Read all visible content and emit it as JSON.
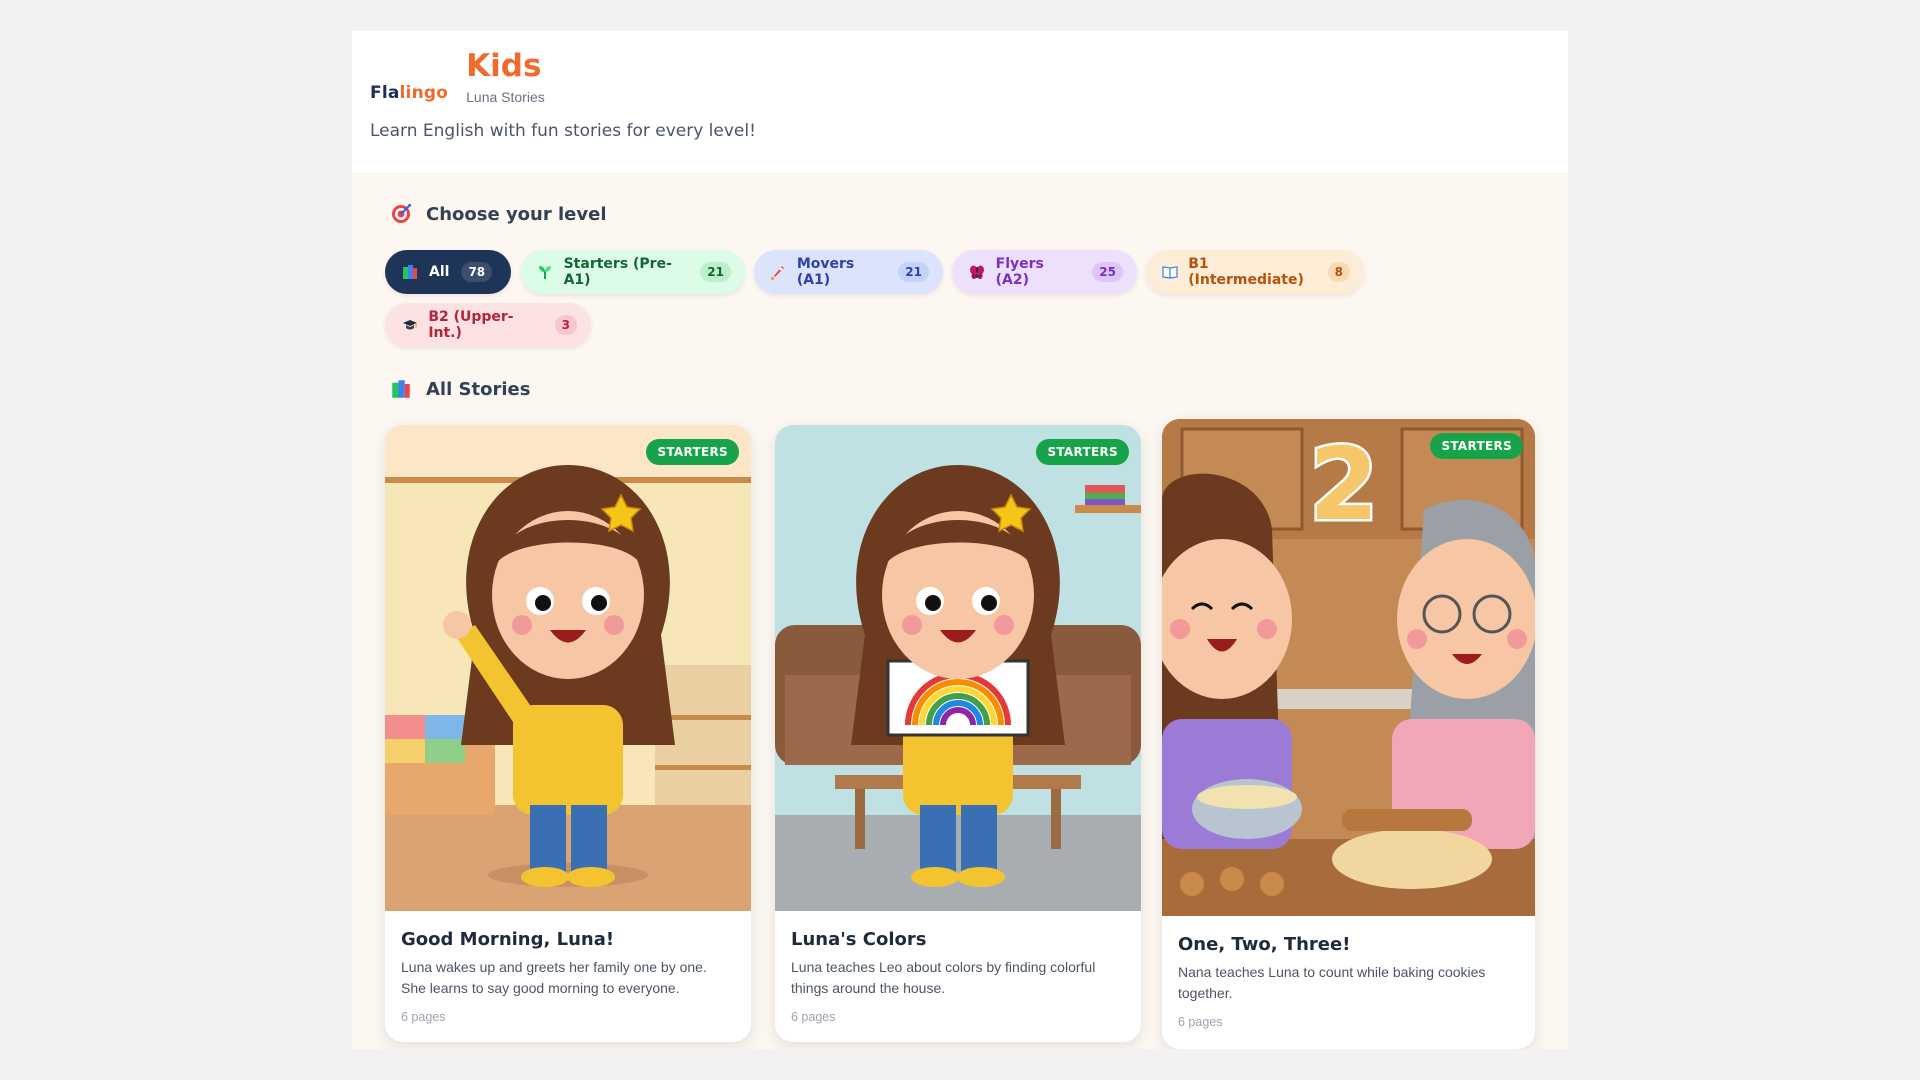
{
  "brand": {
    "logo_part1": "Fla",
    "logo_part2": "lingo",
    "title": "Kids",
    "subtitle": "Luna Stories"
  },
  "tagline": "Learn English with fun stories for every level!",
  "levels": {
    "heading": "Choose your level",
    "heading_icon": "target-icon",
    "items": [
      {
        "label": "All",
        "count": "78",
        "icon": "books-icon",
        "selected": true
      },
      {
        "label": "Starters (Pre-A1)",
        "count": "21",
        "icon": "seedling-icon"
      },
      {
        "label": "Movers (A1)",
        "count": "21",
        "icon": "rocket-icon"
      },
      {
        "label": "Flyers (A2)",
        "count": "25",
        "icon": "butterfly-icon"
      },
      {
        "label": "B1 (Intermediate)",
        "count": "8",
        "icon": "open-book-icon"
      },
      {
        "label": "B2 (Upper-Int.)",
        "count": "3",
        "icon": "graduation-cap-icon"
      }
    ]
  },
  "stories": {
    "heading": "All Stories",
    "heading_icon": "books-icon",
    "items": [
      {
        "badge": "STARTERS",
        "title": "Good Morning, Luna!",
        "description": "Luna wakes up and greets her family one by one. She learns to say good morning to everyone.",
        "pages": "6 pages"
      },
      {
        "badge": "STARTERS",
        "title": "Luna's Colors",
        "description": "Luna teaches Leo about colors by finding colorful things around the house.",
        "pages": "6 pages"
      },
      {
        "badge": "STARTERS",
        "title": "One, Two, Three!",
        "description": "Nana teaches Luna to count while baking cookies together.",
        "pages": "6 pages",
        "illustration_number": "2"
      }
    ]
  },
  "colors": {
    "accent": "#f06a2c",
    "navy": "#1e2f5a",
    "badge_green": "#16a34a"
  }
}
